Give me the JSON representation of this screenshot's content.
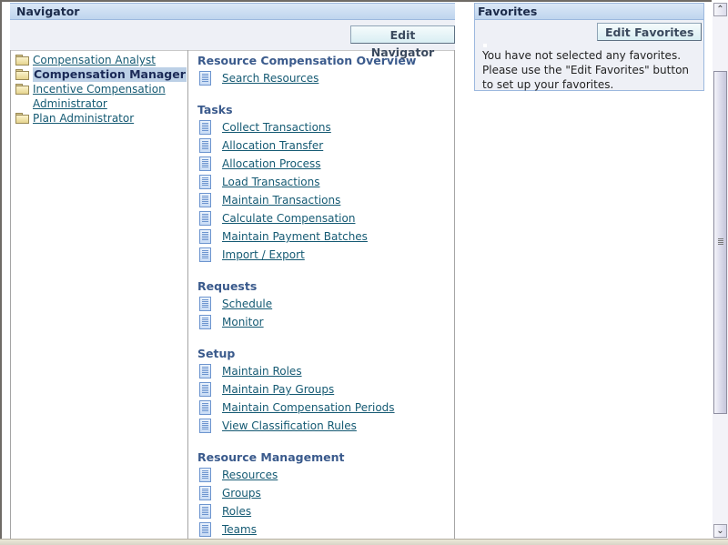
{
  "navigator": {
    "title": "Navigator",
    "edit_button": "Edit Navigator",
    "responsibilities": [
      {
        "label": "Compensation Analyst",
        "selected": false
      },
      {
        "label": "Compensation Manager",
        "selected": true
      },
      {
        "label": "Incentive Compensation Administrator",
        "selected": false
      },
      {
        "label": "Plan Administrator",
        "selected": false
      }
    ],
    "sections": [
      {
        "title": "Resource Compensation Overview",
        "items": [
          "Search Resources"
        ]
      },
      {
        "title": "Tasks",
        "items": [
          "Collect Transactions",
          "Allocation Transfer",
          "Allocation Process",
          "Load Transactions",
          "Maintain Transactions",
          "Calculate Compensation",
          "Maintain Payment Batches",
          "Import / Export"
        ]
      },
      {
        "title": "Requests",
        "items": [
          "Schedule",
          "Monitor"
        ]
      },
      {
        "title": "Setup",
        "items": [
          "Maintain Roles",
          "Maintain Pay Groups",
          "Maintain Compensation Periods",
          "View Classification Rules"
        ]
      },
      {
        "title": "Resource Management",
        "items": [
          "Resources",
          "Groups",
          "Roles",
          "Teams"
        ]
      }
    ]
  },
  "favorites": {
    "title": "Favorites",
    "edit_button": "Edit Favorites",
    "message": "You have not selected any favorites. Please use the \"Edit Favorites\" button to set up your favorites."
  },
  "scrollbar": {
    "up_icon": "chevron-up-icon",
    "down_icon": "chevron-down-icon",
    "position": 0.1
  }
}
